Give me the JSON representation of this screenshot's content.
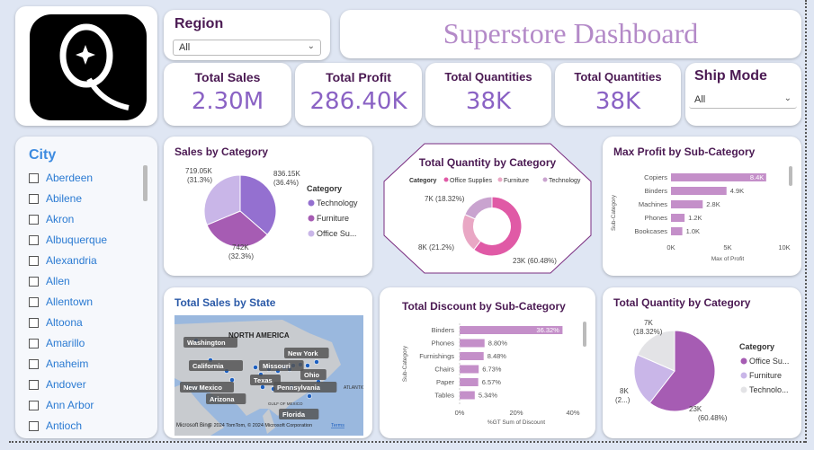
{
  "logo": {
    "letter": "Q"
  },
  "region": {
    "label": "Region",
    "value": "All"
  },
  "title": "Superstore Dashboard",
  "kpis": [
    {
      "title": "Total Sales",
      "value": "2.30M"
    },
    {
      "title": "Total Profit",
      "value": "286.40K"
    },
    {
      "title": "Total Quantities",
      "value": "38K"
    },
    {
      "title": "Total Quantities",
      "value": "38K"
    }
  ],
  "ship_mode": {
    "label": "Ship Mode",
    "value": "All"
  },
  "city": {
    "label": "City",
    "items": [
      "Aberdeen",
      "Abilene",
      "Akron",
      "Albuquerque",
      "Alexandria",
      "Allen",
      "Allentown",
      "Altoona",
      "Amarillo",
      "Anaheim",
      "Andover",
      "Ann Arbor",
      "Antioch"
    ]
  },
  "sales_by_category": {
    "title": "Sales by Category",
    "legend_title": "Category",
    "legend": [
      "Technology",
      "Furniture",
      "Office Su..."
    ],
    "labels": [
      "836.15K",
      "(36.4%)",
      "742K",
      "(32.3%)",
      "719.05K",
      "(31.3%)"
    ]
  },
  "qty_by_category_donut": {
    "title": "Total Quantity by Category",
    "legend_title": "Category",
    "legend": [
      "Office Supplies",
      "Furniture",
      "Technology"
    ],
    "labels": [
      "7K (18.32%)",
      "8K (21.2%)",
      "23K (60.48%)"
    ]
  },
  "max_profit": {
    "title": "Max Profit by Sub-Category",
    "ylabel": "Sub-Category",
    "xlabel": "Max of Profit",
    "ticks": [
      "0K",
      "5K",
      "10K"
    ],
    "labels": [
      "8.4K",
      "4.9K",
      "2.8K",
      "1.2K",
      "1.0K"
    ]
  },
  "sales_by_state": {
    "title": "Total Sales by State",
    "map_labels": [
      "NORTH AMERICA",
      "Washington",
      "New York",
      "California",
      "Missouri",
      "Ohio",
      "Texas",
      "New Mexico",
      "Pennsylvania",
      "Arizona",
      "Florida",
      "GULF OF MEXICO",
      "ATLANTIC OCEAN"
    ],
    "footer": "Microsoft Bing",
    "credit": "© 2024 TomTom, © 2024 Microsoft Corporation",
    "terms": "Terms"
  },
  "discount": {
    "title": "Total Discount by Sub-Category",
    "ylabel": "Sub-Category",
    "xlabel": "%GT Sum of Discount",
    "ticks": [
      "0%",
      "20%",
      "40%"
    ],
    "labels": [
      "36.32%",
      "8.80%",
      "8.48%",
      "6.73%",
      "6.57%",
      "5.34%"
    ]
  },
  "qty_by_category_pie": {
    "title": "Total Quantity by Category",
    "legend_title": "Category",
    "legend": [
      "Office Su...",
      "Furniture",
      "Technolo..."
    ],
    "labels": [
      "7K",
      "(18.32%)",
      "8K",
      "(2...)",
      "23K",
      "(60.48%)"
    ]
  },
  "colors": {
    "purple_dark": "#4b1a53",
    "accent": "#8a62c4",
    "pie1": "#9470d0",
    "pie2": "#a65cb3",
    "pie3": "#c9b6e8",
    "pink": "#e05aa6",
    "pink_light": "#e9a7c4",
    "mauve": "#c9a3cf",
    "bar": "#c48fc9",
    "map_water": "#9ab8de",
    "map_land": "#c8cbcf"
  },
  "chart_data": [
    {
      "type": "pie",
      "title": "Sales by Category",
      "categories": [
        "Technology",
        "Furniture",
        "Office Supplies"
      ],
      "values": [
        836150,
        742000,
        719050
      ],
      "percent": [
        36.4,
        32.3,
        31.3
      ]
    },
    {
      "type": "pie",
      "title": "Total Quantity by Category",
      "categories": [
        "Office Supplies",
        "Furniture",
        "Technology"
      ],
      "values": [
        23000,
        8000,
        7000
      ],
      "percent": [
        60.48,
        21.2,
        18.32
      ]
    },
    {
      "type": "bar",
      "title": "Max Profit by Sub-Category",
      "categories": [
        "Copiers",
        "Binders",
        "Machines",
        "Phones",
        "Bookcases"
      ],
      "values": [
        8400,
        4900,
        2800,
        1200,
        1000
      ],
      "xlim": [
        0,
        10000
      ]
    },
    {
      "type": "bar",
      "title": "Total Discount by Sub-Category",
      "categories": [
        "Binders",
        "Phones",
        "Furnishings",
        "Chairs",
        "Paper",
        "Tables"
      ],
      "values": [
        36.32,
        8.8,
        8.48,
        6.73,
        6.57,
        5.34
      ],
      "xlim": [
        0,
        40
      ]
    },
    {
      "type": "pie",
      "title": "Total Quantity by Category",
      "categories": [
        "Office Supplies",
        "Furniture",
        "Technology"
      ],
      "values": [
        23000,
        8000,
        7000
      ],
      "percent": [
        60.48,
        21.2,
        18.32
      ]
    }
  ]
}
